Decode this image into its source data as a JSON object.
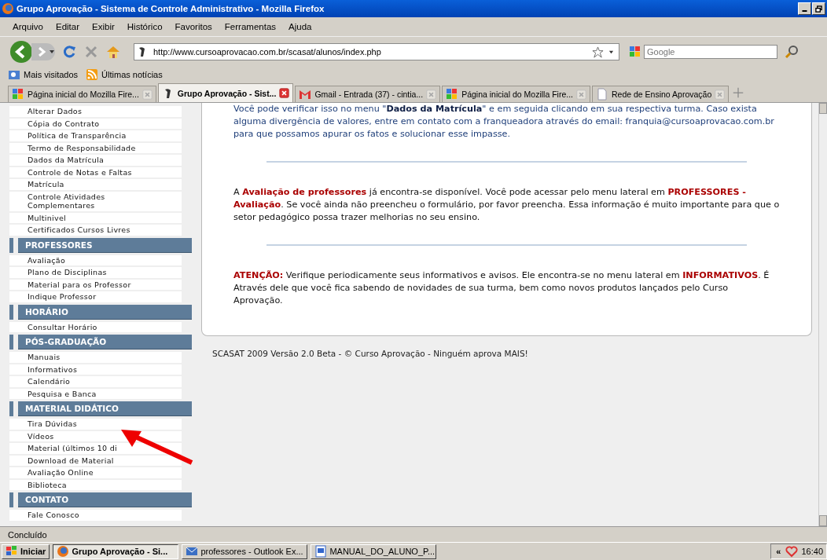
{
  "window": {
    "title": "Grupo Aprovação - Sistema de Controle Administrativo - Mozilla Firefox"
  },
  "menu": [
    "Arquivo",
    "Editar",
    "Exibir",
    "Histórico",
    "Favoritos",
    "Ferramentas",
    "Ajuda"
  ],
  "address": {
    "value": "http://www.cursoaprovacao.com.br/scasat/alunos/index.php"
  },
  "search": {
    "placeholder": "Google"
  },
  "bookmarks": [
    {
      "label": "Mais visitados",
      "kind": "folder"
    },
    {
      "label": "Últimas notícias",
      "kind": "feed"
    }
  ],
  "tabs": [
    {
      "label": "Página inicial do Mozilla Fire...",
      "kind": "google",
      "selected": false
    },
    {
      "label": "Grupo Aprovação - Sist...",
      "kind": "site",
      "selected": true
    },
    {
      "label": "Gmail - Entrada (37) - cintia...",
      "kind": "gmail",
      "selected": false
    },
    {
      "label": "Página inicial do Mozilla Fire...",
      "kind": "google",
      "selected": false
    },
    {
      "label": "Rede de Ensino Aprovação",
      "kind": "page",
      "selected": false
    }
  ],
  "sidebar": {
    "sections": [
      {
        "items": [
          "Alterar Dados",
          "Cópia do Contrato",
          "Política de Transparência",
          "Termo de Responsabilidade",
          "Dados da Matrícula",
          "Controle de Notas e Faltas",
          "Matrícula",
          "Controle Atividades Complementares",
          "Multinivel",
          "Certificados Cursos Livres"
        ]
      },
      {
        "title": "PROFESSORES",
        "items": [
          "Avaliação",
          "Plano de Disciplinas",
          "Material para os Professor",
          "Indique Professor"
        ]
      },
      {
        "title": "HORÁRIO",
        "items": [
          "Consultar Horário"
        ]
      },
      {
        "title": "PÓS-GRADUAÇÃO",
        "items": [
          "Manuais",
          "Informativos",
          "Calendário",
          "Pesquisa e Banca"
        ]
      },
      {
        "title": "MATERIAL DIDÁTICO",
        "items": [
          "Tira Dúvidas",
          "Vídeos",
          "Material (últimos 10 di",
          "Download de Material",
          "Avaliação Online",
          "Biblioteca"
        ]
      },
      {
        "title": "CONTATO",
        "items": [
          "Fale Conosco"
        ]
      }
    ]
  },
  "notices": [
    {
      "kind": "info",
      "text": "Você pode verificar isso no menu \"**Dados da Matrícula**\" e em seguida clicando em sua respectiva turma. Caso exista alguma divergência de valores, entre em contato com a franqueadora através do email: franquia@cursoaprovacao.com.br para que possamos apurar os fatos e solucionar esse impasse."
    },
    {
      "kind": "alert",
      "text": "A **Avaliação de professores** já encontra-se disponível. Você pode acessar pelo menu lateral em **PROFESSORES - Avaliação**. Se você ainda não preencheu o formulário, por favor preencha. Essa informação é muito importante para que o setor pedagógico possa trazer melhorias no seu ensino."
    },
    {
      "kind": "alert",
      "text": "**ATENÇÃO:** Verifique periodicamente seus informativos e avisos. Ele encontra-se no menu lateral em **INFORMATIVOS**. É Através dele que você fica sabendo de novidades de sua turma, bem como novos produtos lançados pelo Curso Aprovação."
    }
  ],
  "footer": "SCASAT 2009 Versão 2.0 Beta - © Curso Aprovação - Ninguém aprova MAIS!",
  "status_bar": "Concluído",
  "taskbar": {
    "start": "Iniciar",
    "tasks": [
      {
        "label": "Grupo Aprovação - Si...",
        "kind": "firefox",
        "selected": true
      },
      {
        "label": "professores - Outlook Ex...",
        "kind": "outlook",
        "selected": false
      },
      {
        "label": "MANUAL_DO_ALUNO_P...",
        "kind": "word",
        "selected": false
      }
    ],
    "tray_toggle": "«",
    "clock": "16:40"
  }
}
